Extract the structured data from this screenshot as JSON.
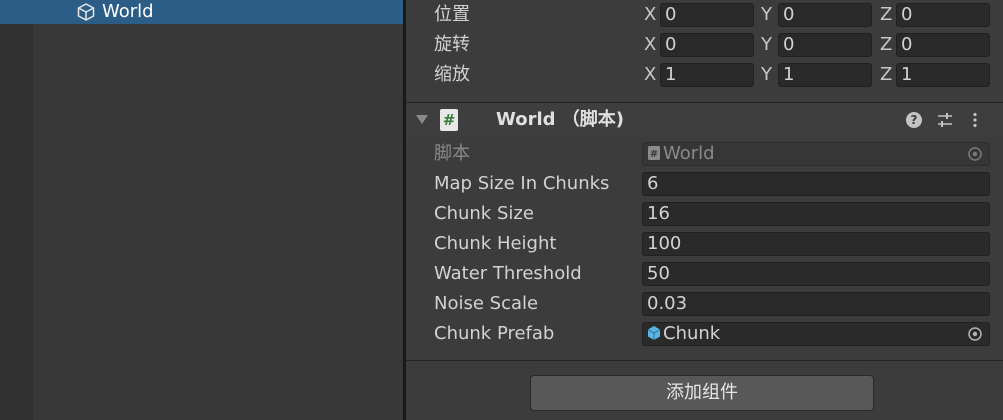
{
  "hierarchy": {
    "selected_item": {
      "label": "World",
      "icon": "cube-icon"
    }
  },
  "transform": {
    "position": {
      "label": "位置",
      "x": "0",
      "y": "0",
      "z": "0"
    },
    "rotation": {
      "label": "旋转",
      "x": "0",
      "y": "0",
      "z": "0"
    },
    "scale": {
      "label": "缩放",
      "x": "1",
      "y": "1",
      "z": "1"
    },
    "axis_letters": {
      "x": "X",
      "y": "Y",
      "z": "Z"
    }
  },
  "component": {
    "title": "World （脚本)",
    "script_icon_glyph": "#",
    "help_glyph": "?",
    "fields": [
      {
        "label": "脚本",
        "value": "World",
        "kind": "object",
        "icon": "script-icon"
      },
      {
        "label": "Map Size In Chunks",
        "value": "6"
      },
      {
        "label": "Chunk Size",
        "value": "16"
      },
      {
        "label": "Chunk Height",
        "value": "100"
      },
      {
        "label": "Water Threshold",
        "value": "50"
      },
      {
        "label": "Noise Scale",
        "value": "0.03"
      },
      {
        "label": "Chunk Prefab",
        "value": "Chunk",
        "kind": "object",
        "icon": "prefab-cube-icon"
      }
    ]
  },
  "add_component_label": "添加组件",
  "colors": {
    "selection": "#2c5d87",
    "panel_bg": "#383838",
    "inspector_bg": "#3c3c3c",
    "field_bg": "#2a2a2a",
    "prefab_icon": "#5ab4e6"
  }
}
